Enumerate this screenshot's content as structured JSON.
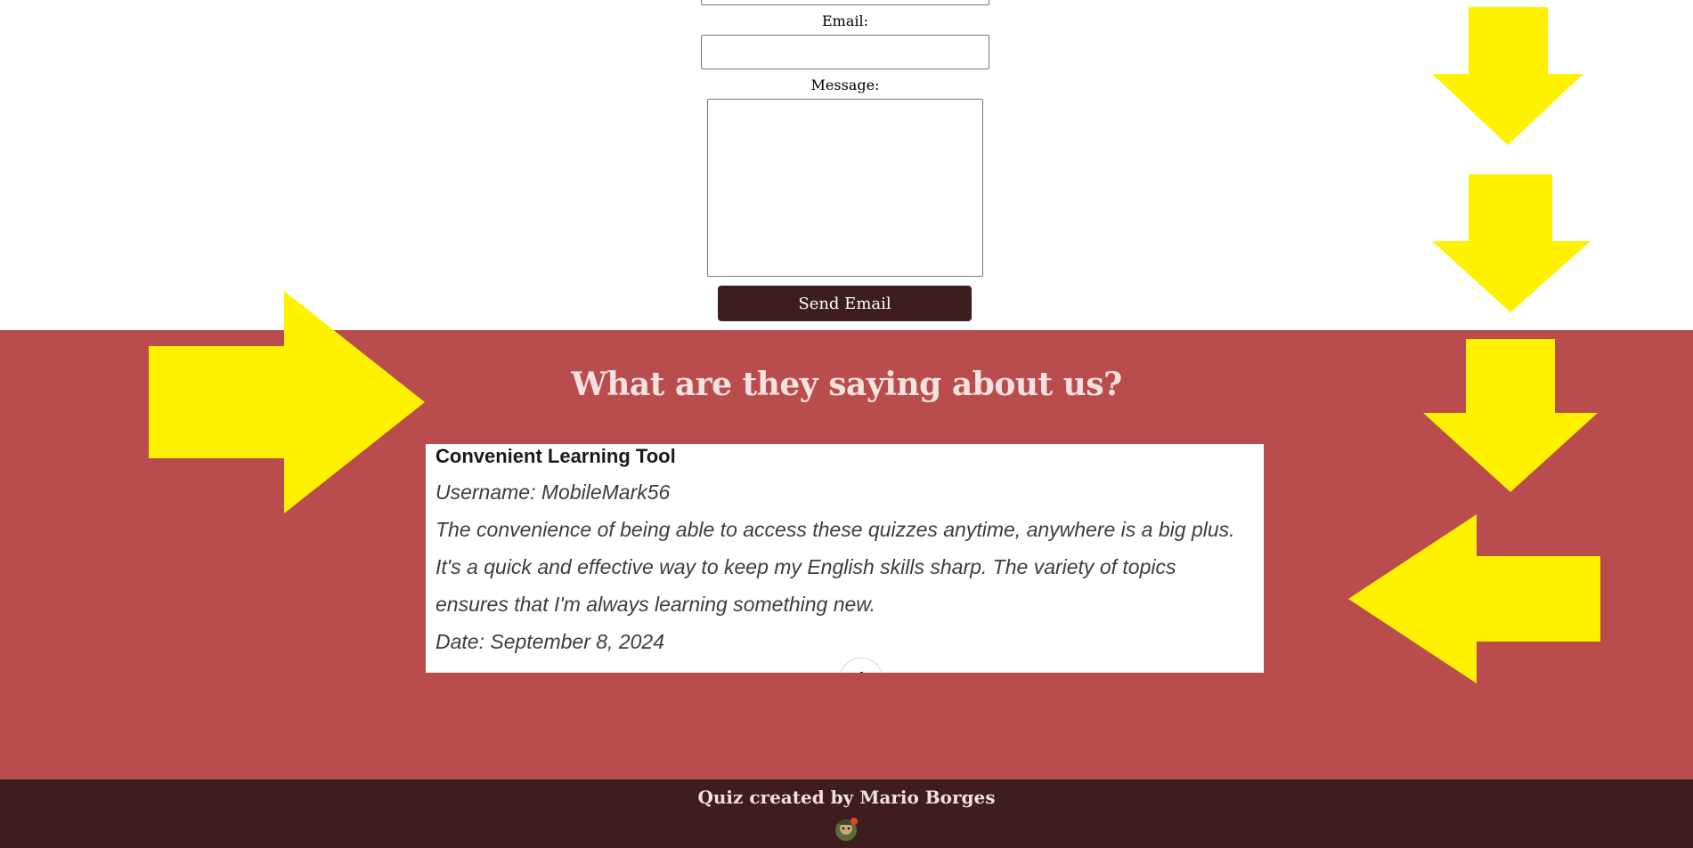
{
  "contact_form": {
    "email_label": "Email:",
    "email_value": "",
    "message_label": "Message:",
    "message_value": "",
    "send_label": "Send Email"
  },
  "testimonials": {
    "heading": "What are they saying about us?",
    "card": {
      "title": "Convenient Learning Tool",
      "username": "Username: MobileMark56",
      "body_lines": [
        "The convenience of being able to access these quizzes anytime, anywhere is a big plus.",
        "It's a quick and effective way to keep my English skills sharp. The variety of topics",
        "ensures that I'm always learning something new."
      ],
      "date": "Date: September 8, 2024"
    }
  },
  "footer": {
    "credit": "Quiz created by Mario Borges",
    "logo_icon": "quiz-logo-icon"
  },
  "colors": {
    "testimonial_bg": "#b94d4d",
    "dark_maroon": "#3e1d1e",
    "heading_text": "#f4e2e0",
    "annotation_arrow": "#fff200"
  },
  "annotations": {
    "arrow_icons": [
      "arrow-down-icon",
      "arrow-down-icon",
      "arrow-down-icon",
      "arrow-right-icon",
      "arrow-left-icon"
    ]
  }
}
